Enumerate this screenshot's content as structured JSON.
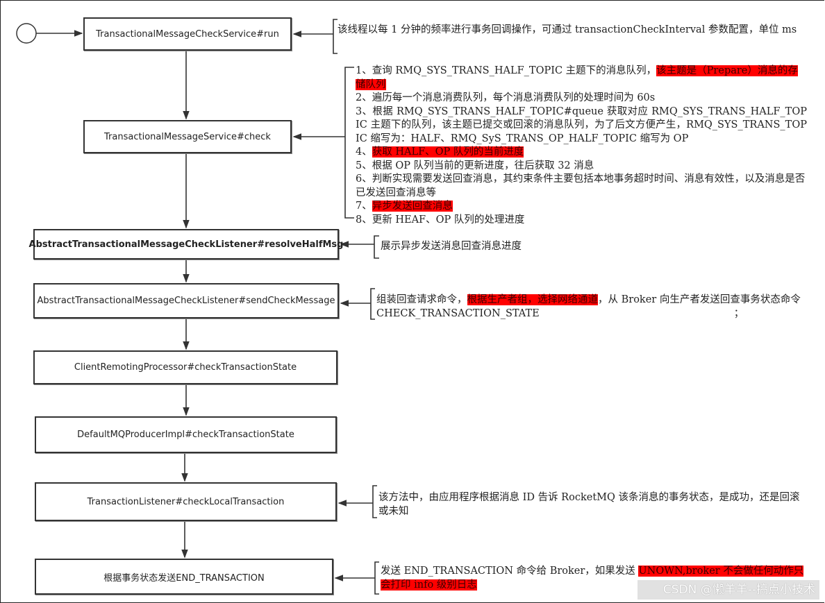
{
  "boxes": [
    {
      "label": "TransactionalMessageCheckService#run"
    },
    {
      "label": "TransactionalMessageService#check"
    },
    {
      "label": "AbstractTransactionalMessageCheckListener#resolveHalfMsg"
    },
    {
      "label": "AbstractTransactionalMessageCheckListener#sendCheckMessage"
    },
    {
      "label": "ClientRemotingProcessor#checkTransactionState"
    },
    {
      "label": "DefaultMQProducerImpl#checkTransactionState"
    },
    {
      "label": "TransactionListener#checkLocalTransaction"
    },
    {
      "label": "根据事务状态发送END_TRANSACTION"
    }
  ],
  "notes": {
    "run": "该线程以每 1 分钟的频率进行事务回调操作，可通过 transactionCheckInterval 参数配置，单位 ms",
    "check": {
      "item1_a": "1、查询 RMQ_SYS_TRANS_HALF_TOPIC 主题下的消息队列，",
      "item1_hl": "该主题是（Prepare）消息的存储队列",
      "item2": "2、遍历每一个消息消费队列，每个消息消费队列的处理时间为 60s",
      "item3": "3、根据 RMQ_SYS_TRANS_HALF_TOPIC#queue 获取对应 RMQ_SYS_TRANS_HALF_TOPIC 主题下的队列，该主题已提交或回滚的消息队列，为了后文方便产生，RMQ_SYS_TRANS_TOPIC 缩写为：HALF、RMQ_SyS_TRANS_OP_HALF_TOPIC 缩写为 OP",
      "item4_a": "4、",
      "item4_hl": "获取 HALF、OP 队列的当前进度",
      "item5": "5、根据 OP 队列当前的更新进度，往后获取 32 消息",
      "item6": "6、判断实现需要发送回查消息，其约束条件主要包括本地事务超时时间、消息有效性，以及消息是否已发送回查消息等",
      "item7_a": "7、",
      "item7_hl": "异步发送回查消息",
      "item8": "8、更新 HEAF、OP 队列的处理进度"
    },
    "resolve": "展示异步发送消息回查消息进度",
    "send": {
      "a": "组装回查请求命令，",
      "hl": "根据生产者组，选择网络通道",
      "b": "，从 Broker 向生产者发送回查事务状态命令 CHECK_TRANSACTION_STATE",
      "c": "；"
    },
    "local": "该方法中，由应用程序根据消息 ID 告诉 RocketMQ 该条消息的事务状态，是成功，还是回滚或未知",
    "end": {
      "a": "发送 END_TRANSACTION 命令给 Broker，如果发送 ",
      "hl": "UNOWN,broker 不会做任何动作只会打印 info 级别日志"
    }
  },
  "watermark": "CSDN @懒羊羊--搞点小技术",
  "colors": {
    "highlight": "#ff0000",
    "line": "#333333"
  }
}
